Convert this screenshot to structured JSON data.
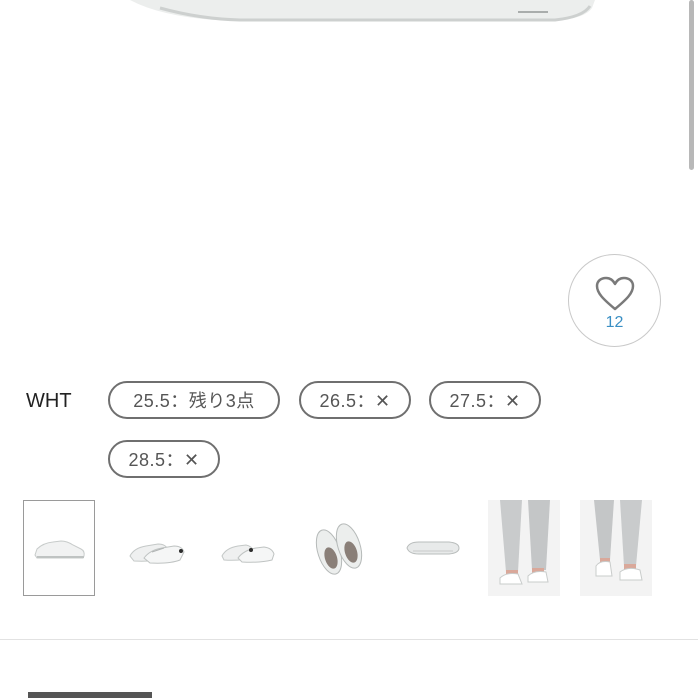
{
  "favorite": {
    "count": "12"
  },
  "color": {
    "name": "WHT"
  },
  "sizes": [
    {
      "label": "25.5：残り3点"
    },
    {
      "label": "26.5：✕"
    },
    {
      "label": "27.5：✕"
    },
    {
      "label": "28.5：✕"
    }
  ],
  "thumbnails": [
    {
      "name": "thumb-side-view",
      "selected": true
    },
    {
      "name": "thumb-pair-angle"
    },
    {
      "name": "thumb-pair-side"
    },
    {
      "name": "thumb-top-view"
    },
    {
      "name": "thumb-sole-view"
    },
    {
      "name": "thumb-model-worn-1"
    },
    {
      "name": "thumb-model-worn-2"
    }
  ],
  "colors": {
    "accent": "#3a8fc4",
    "chip_border": "#6f6f6f"
  }
}
